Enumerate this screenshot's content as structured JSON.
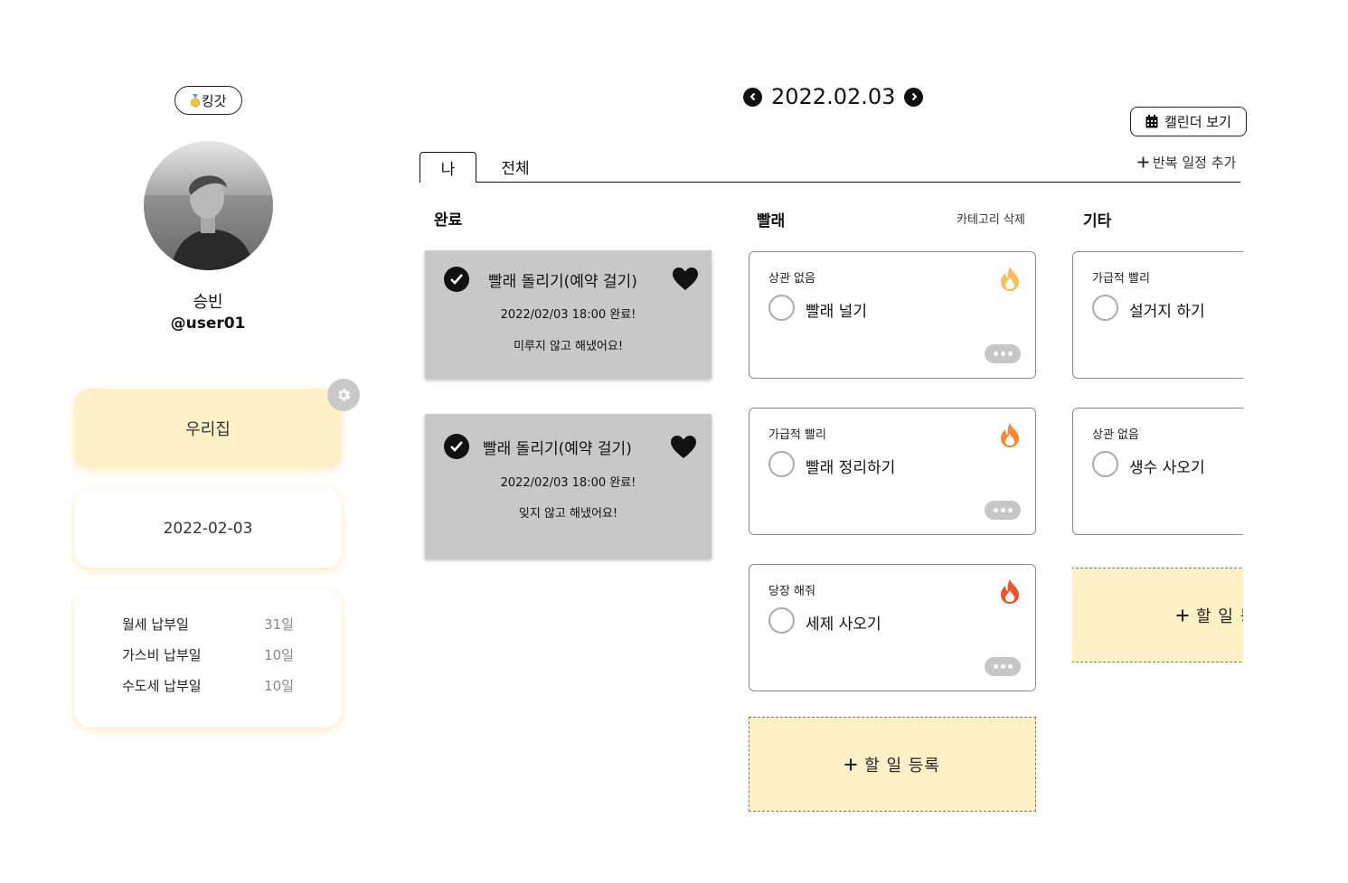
{
  "profile": {
    "badge_label": "킹갓",
    "name": "승빈",
    "user_id": "@user01"
  },
  "sidebar": {
    "home_label": "우리집",
    "date": "2022-02-03",
    "dues": [
      {
        "label": "월세 납부일",
        "day": "31일"
      },
      {
        "label": "가스비 납부일",
        "day": "10일"
      },
      {
        "label": "수도세 납부일",
        "day": "10일"
      }
    ]
  },
  "header": {
    "current_date": "2022.02.03",
    "calendar_button": "캘린더 보기",
    "repeat_add": "반복 일정 추가"
  },
  "tabs": {
    "me": "나",
    "all": "전체"
  },
  "columns": {
    "done": {
      "title": "완료",
      "items": [
        {
          "title": "빨래 돌리기(예약 걸기)",
          "meta": "2022/02/03  18:00  완료!",
          "note": "미루지 않고 해냈어요!"
        },
        {
          "title": "빨래 돌리기(예약 걸기)",
          "meta": "2022/02/03  18:00  완료!",
          "note": "잊지 않고 해냈어요!"
        }
      ]
    },
    "laundry": {
      "title": "빨래",
      "delete_label": "카테고리 삭제",
      "items": [
        {
          "priority": "상관 없음",
          "task": "빨래 널기",
          "fire_color": "#f7bd56"
        },
        {
          "priority": "가급적 빨리",
          "task": "빨래 정리하기",
          "fire_color": "#f58a35"
        },
        {
          "priority": "당장 해줘",
          "task": "세제 사오기",
          "fire_color": "#f0522c"
        }
      ],
      "add_label": "할 일 등록"
    },
    "etc": {
      "title": "기타",
      "items": [
        {
          "priority": "가급적 빨리",
          "task": "설거지 하기"
        },
        {
          "priority": "상관 없음",
          "task": "생수 사오기"
        }
      ],
      "add_label": "할 일 등록"
    }
  },
  "colors": {
    "accent_yellow": "#fff1c7",
    "done_gray": "#c8c8c8"
  }
}
